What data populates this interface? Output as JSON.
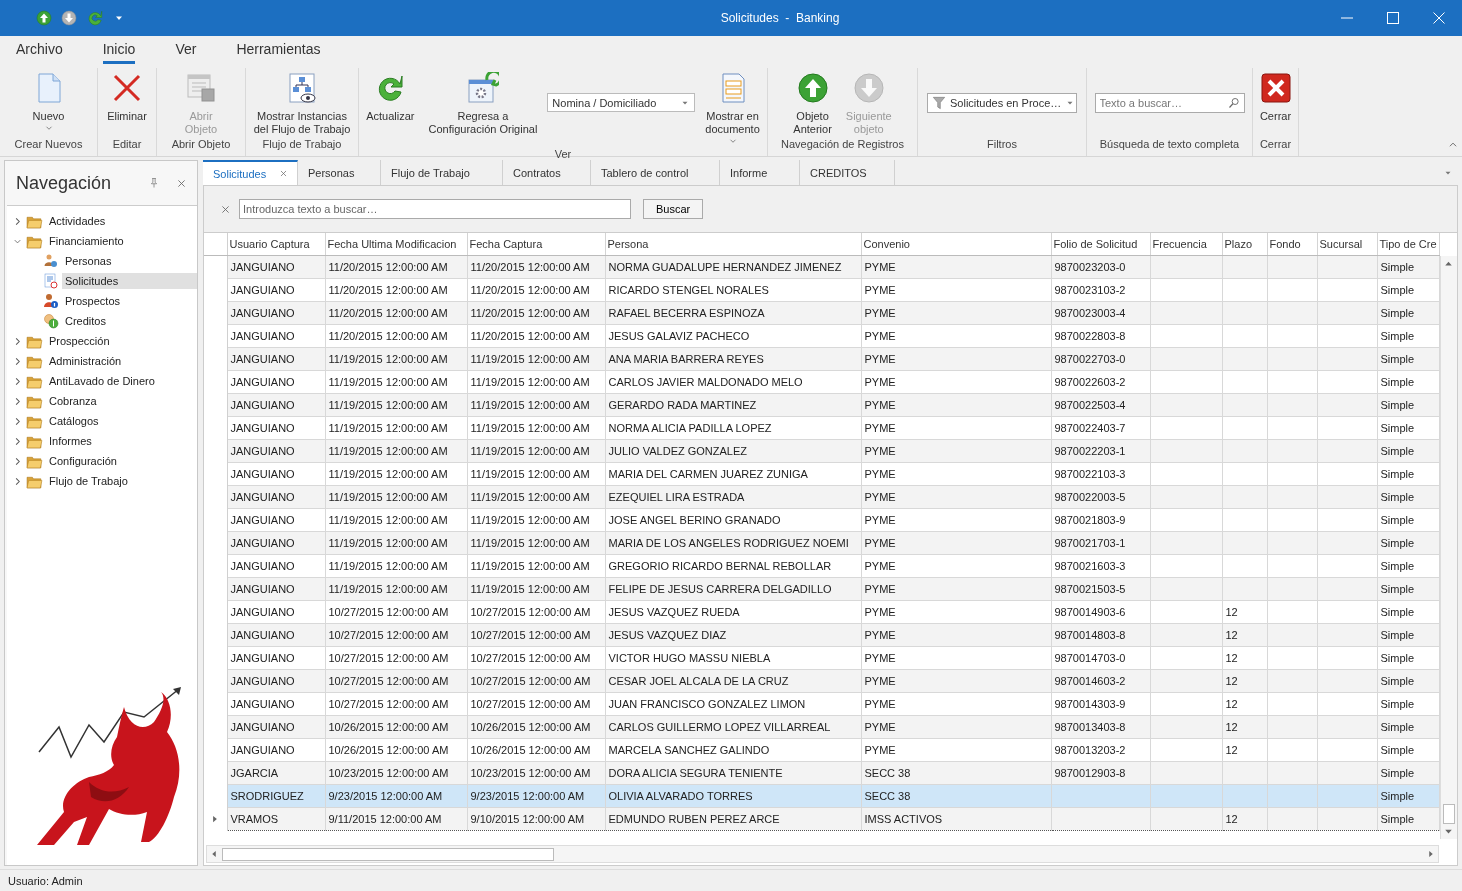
{
  "window": {
    "title": "Solicitudes  -  Banking"
  },
  "menu_tabs": [
    {
      "label": "Archivo",
      "selected": false
    },
    {
      "label": "Inicio",
      "selected": true
    },
    {
      "label": "Ver",
      "selected": false
    },
    {
      "label": "Herramientas",
      "selected": false
    }
  ],
  "ribbon": {
    "groups": [
      {
        "label": "Crear Nuevos",
        "items": [
          {
            "kind": "button",
            "label": "Nuevo",
            "disabled": false,
            "dropdown": true
          }
        ]
      },
      {
        "label": "Editar",
        "items": [
          {
            "kind": "button",
            "label": "Eliminar",
            "disabled": false,
            "dropdown": false
          }
        ]
      },
      {
        "label": "Abrir Objeto",
        "items": [
          {
            "kind": "button",
            "label": "Abrir\nObjeto",
            "disabled": true,
            "dropdown": false
          }
        ]
      },
      {
        "label": "Flujo de Trabajo",
        "items": [
          {
            "kind": "button",
            "label": "Mostrar Instancias\ndel Flujo de Trabajo",
            "disabled": false,
            "dropdown": false
          }
        ]
      },
      {
        "label": "Ver",
        "items": [
          {
            "kind": "button",
            "label": "Actualizar",
            "disabled": false,
            "dropdown": false
          },
          {
            "kind": "button",
            "label": "Regresa a\nConfiguración Original",
            "disabled": false,
            "dropdown": false
          },
          {
            "kind": "combo",
            "value": "Nomina / Domiciliado"
          },
          {
            "kind": "button",
            "label": "Mostrar en\ndocumento",
            "disabled": false,
            "dropdown": true
          }
        ]
      },
      {
        "label": "Navegación de Registros",
        "items": [
          {
            "kind": "button",
            "label": "Objeto\nAnterior",
            "disabled": false,
            "dropdown": false
          },
          {
            "kind": "button",
            "label": "Siguiente\nobjeto",
            "disabled": true,
            "dropdown": false
          }
        ]
      },
      {
        "label": "Filtros",
        "items": [
          {
            "kind": "filter",
            "value": "Solicitudes en Proce…"
          }
        ]
      },
      {
        "label": "Búsqueda de texto completa",
        "items": [
          {
            "kind": "search",
            "placeholder": "Texto a buscar…"
          }
        ]
      },
      {
        "label": "Cerrar",
        "items": [
          {
            "kind": "button",
            "label": "Cerrar",
            "disabled": false,
            "dropdown": false
          }
        ]
      }
    ]
  },
  "navigation": {
    "title": "Navegación",
    "tree": [
      {
        "label": "Actividades",
        "expanded": false,
        "selected": false
      },
      {
        "label": "Financiamiento",
        "expanded": true,
        "selected": false,
        "children": [
          {
            "label": "Personas",
            "selected": false
          },
          {
            "label": "Solicitudes",
            "selected": true
          },
          {
            "label": "Prospectos",
            "selected": false
          },
          {
            "label": "Creditos",
            "selected": false
          }
        ]
      },
      {
        "label": "Prospección",
        "expanded": false,
        "selected": false
      },
      {
        "label": "Administración",
        "expanded": false,
        "selected": false
      },
      {
        "label": "AntiLavado de Dinero",
        "expanded": false,
        "selected": false
      },
      {
        "label": "Cobranza",
        "expanded": false,
        "selected": false
      },
      {
        "label": "Catálogos",
        "expanded": false,
        "selected": false
      },
      {
        "label": "Informes",
        "expanded": false,
        "selected": false
      },
      {
        "label": "Configuración",
        "expanded": false,
        "selected": false
      },
      {
        "label": "Flujo de Trabajo",
        "expanded": false,
        "selected": false
      }
    ]
  },
  "doc_tabs": [
    {
      "label": "Solicitudes",
      "selected": true,
      "closable": true
    },
    {
      "label": "Personas",
      "selected": false,
      "closable": false
    },
    {
      "label": "Flujo de Trabajo",
      "selected": false,
      "closable": false
    },
    {
      "label": "Contratos",
      "selected": false,
      "closable": false
    },
    {
      "label": "Tablero de control",
      "selected": false,
      "closable": false
    },
    {
      "label": "Informe",
      "selected": false,
      "closable": false
    },
    {
      "label": "CREDITOS",
      "selected": false,
      "closable": false
    }
  ],
  "grid": {
    "search": {
      "placeholder": "Introduzca texto a buscar…",
      "button": "Buscar"
    },
    "columns": [
      "Usuario Captura",
      "Fecha Ultima Modificacion",
      "Fecha Captura",
      "Persona",
      "Convenio",
      "Folio de Solicitud",
      "Frecuencia",
      "Plazo",
      "Fondo",
      "Sucursal",
      "Tipo de Cre"
    ],
    "rows": [
      {
        "selected": false,
        "current": false,
        "cells": {
          "usuario": "JANGUIANO",
          "modificacion": "11/20/2015 12:00:00 AM",
          "captura": "11/20/2015 12:00:00 AM",
          "persona": "NORMA GUADALUPE HERNANDEZ JIMENEZ",
          "convenio": "PYME",
          "folio": "9870023203-0",
          "tipo": "Simple"
        }
      },
      {
        "selected": false,
        "current": false,
        "cells": {
          "usuario": "JANGUIANO",
          "modificacion": "11/20/2015 12:00:00 AM",
          "captura": "11/20/2015 12:00:00 AM",
          "persona": "RICARDO STENGEL NORALES",
          "convenio": "PYME",
          "folio": "9870023103-2",
          "tipo": "Simple"
        }
      },
      {
        "selected": false,
        "current": false,
        "cells": {
          "usuario": "JANGUIANO",
          "modificacion": "11/20/2015 12:00:00 AM",
          "captura": "11/20/2015 12:00:00 AM",
          "persona": "RAFAEL BECERRA ESPINOZA",
          "convenio": "PYME",
          "folio": "9870023003-4",
          "tipo": "Simple"
        }
      },
      {
        "selected": false,
        "current": false,
        "cells": {
          "usuario": "JANGUIANO",
          "modificacion": "11/20/2015 12:00:00 AM",
          "captura": "11/20/2015 12:00:00 AM",
          "persona": "JESUS GALAVIZ PACHECO",
          "convenio": "PYME",
          "folio": "9870022803-8",
          "tipo": "Simple"
        }
      },
      {
        "selected": false,
        "current": false,
        "cells": {
          "usuario": "JANGUIANO",
          "modificacion": "11/19/2015 12:00:00 AM",
          "captura": "11/19/2015 12:00:00 AM",
          "persona": "ANA MARIA BARRERA REYES",
          "convenio": "PYME",
          "folio": "9870022703-0",
          "tipo": "Simple"
        }
      },
      {
        "selected": false,
        "current": false,
        "cells": {
          "usuario": "JANGUIANO",
          "modificacion": "11/19/2015 12:00:00 AM",
          "captura": "11/19/2015 12:00:00 AM",
          "persona": "CARLOS JAVIER MALDONADO MELO",
          "convenio": "PYME",
          "folio": "9870022603-2",
          "tipo": "Simple"
        }
      },
      {
        "selected": false,
        "current": false,
        "cells": {
          "usuario": "JANGUIANO",
          "modificacion": "11/19/2015 12:00:00 AM",
          "captura": "11/19/2015 12:00:00 AM",
          "persona": "GERARDO RADA MARTINEZ",
          "convenio": "PYME",
          "folio": "9870022503-4",
          "tipo": "Simple"
        }
      },
      {
        "selected": false,
        "current": false,
        "cells": {
          "usuario": "JANGUIANO",
          "modificacion": "11/19/2015 12:00:00 AM",
          "captura": "11/19/2015 12:00:00 AM",
          "persona": "NORMA ALICIA PADILLA LOPEZ",
          "convenio": "PYME",
          "folio": "9870022403-7",
          "tipo": "Simple"
        }
      },
      {
        "selected": false,
        "current": false,
        "cells": {
          "usuario": "JANGUIANO",
          "modificacion": "11/19/2015 12:00:00 AM",
          "captura": "11/19/2015 12:00:00 AM",
          "persona": "JULIO VALDEZ GONZALEZ",
          "convenio": "PYME",
          "folio": "9870022203-1",
          "tipo": "Simple"
        }
      },
      {
        "selected": false,
        "current": false,
        "cells": {
          "usuario": "JANGUIANO",
          "modificacion": "11/19/2015 12:00:00 AM",
          "captura": "11/19/2015 12:00:00 AM",
          "persona": "MARIA DEL CARMEN JUAREZ ZUNIGA",
          "convenio": "PYME",
          "folio": "9870022103-3",
          "tipo": "Simple"
        }
      },
      {
        "selected": false,
        "current": false,
        "cells": {
          "usuario": "JANGUIANO",
          "modificacion": "11/19/2015 12:00:00 AM",
          "captura": "11/19/2015 12:00:00 AM",
          "persona": "EZEQUIEL LIRA ESTRADA",
          "convenio": "PYME",
          "folio": "9870022003-5",
          "tipo": "Simple"
        }
      },
      {
        "selected": false,
        "current": false,
        "cells": {
          "usuario": "JANGUIANO",
          "modificacion": "11/19/2015 12:00:00 AM",
          "captura": "11/19/2015 12:00:00 AM",
          "persona": "JOSE ANGEL BERINO GRANADO",
          "convenio": "PYME",
          "folio": "9870021803-9",
          "tipo": "Simple"
        }
      },
      {
        "selected": false,
        "current": false,
        "cells": {
          "usuario": "JANGUIANO",
          "modificacion": "11/19/2015 12:00:00 AM",
          "captura": "11/19/2015 12:00:00 AM",
          "persona": "MARIA DE LOS ANGELES RODRIGUEZ NOEMI",
          "convenio": "PYME",
          "folio": "9870021703-1",
          "tipo": "Simple"
        }
      },
      {
        "selected": false,
        "current": false,
        "cells": {
          "usuario": "JANGUIANO",
          "modificacion": "11/19/2015 12:00:00 AM",
          "captura": "11/19/2015 12:00:00 AM",
          "persona": "GREGORIO RICARDO BERNAL REBOLLAR",
          "convenio": "PYME",
          "folio": "9870021603-3",
          "tipo": "Simple"
        }
      },
      {
        "selected": false,
        "current": false,
        "cells": {
          "usuario": "JANGUIANO",
          "modificacion": "11/19/2015 12:00:00 AM",
          "captura": "11/19/2015 12:00:00 AM",
          "persona": "FELIPE DE JESUS CARRERA DELGADILLO",
          "convenio": "PYME",
          "folio": "9870021503-5",
          "tipo": "Simple"
        }
      },
      {
        "selected": false,
        "current": false,
        "cells": {
          "usuario": "JANGUIANO",
          "modificacion": "10/27/2015 12:00:00 AM",
          "captura": "10/27/2015 12:00:00 AM",
          "persona": "JESUS VAZQUEZ RUEDA",
          "convenio": "PYME",
          "folio": "9870014903-6",
          "plazo": "12",
          "tipo": "Simple"
        }
      },
      {
        "selected": false,
        "current": false,
        "cells": {
          "usuario": "JANGUIANO",
          "modificacion": "10/27/2015 12:00:00 AM",
          "captura": "10/27/2015 12:00:00 AM",
          "persona": "JESUS VAZQUEZ DIAZ",
          "convenio": "PYME",
          "folio": "9870014803-8",
          "plazo": "12",
          "tipo": "Simple"
        }
      },
      {
        "selected": false,
        "current": false,
        "cells": {
          "usuario": "JANGUIANO",
          "modificacion": "10/27/2015 12:00:00 AM",
          "captura": "10/27/2015 12:00:00 AM",
          "persona": "VICTOR HUGO MASSU NIEBLA",
          "convenio": "PYME",
          "folio": "9870014703-0",
          "plazo": "12",
          "tipo": "Simple"
        }
      },
      {
        "selected": false,
        "current": false,
        "cells": {
          "usuario": "JANGUIANO",
          "modificacion": "10/27/2015 12:00:00 AM",
          "captura": "10/27/2015 12:00:00 AM",
          "persona": "CESAR JOEL ALCALA DE LA CRUZ",
          "convenio": "PYME",
          "folio": "9870014603-2",
          "plazo": "12",
          "tipo": "Simple"
        }
      },
      {
        "selected": false,
        "current": false,
        "cells": {
          "usuario": "JANGUIANO",
          "modificacion": "10/27/2015 12:00:00 AM",
          "captura": "10/27/2015 12:00:00 AM",
          "persona": "JUAN FRANCISCO GONZALEZ LIMON",
          "convenio": "PYME",
          "folio": "9870014303-9",
          "plazo": "12",
          "tipo": "Simple"
        }
      },
      {
        "selected": false,
        "current": false,
        "cells": {
          "usuario": "JANGUIANO",
          "modificacion": "10/26/2015 12:00:00 AM",
          "captura": "10/26/2015 12:00:00 AM",
          "persona": "CARLOS GUILLERMO LOPEZ VILLARREAL",
          "convenio": "PYME",
          "folio": "9870013403-8",
          "plazo": "12",
          "tipo": "Simple"
        }
      },
      {
        "selected": false,
        "current": false,
        "cells": {
          "usuario": "JANGUIANO",
          "modificacion": "10/26/2015 12:00:00 AM",
          "captura": "10/26/2015 12:00:00 AM",
          "persona": "MARCELA SANCHEZ GALINDO",
          "convenio": "PYME",
          "folio": "9870013203-2",
          "plazo": "12",
          "tipo": "Simple"
        }
      },
      {
        "selected": false,
        "current": false,
        "cells": {
          "usuario": "JGARCIA",
          "modificacion": "10/23/2015 12:00:00 AM",
          "captura": "10/23/2015 12:00:00 AM",
          "persona": "DORA ALICIA SEGURA TENIENTE",
          "convenio": "SECC 38",
          "folio": "9870012903-8",
          "tipo": "Simple"
        }
      },
      {
        "selected": true,
        "current": false,
        "cells": {
          "usuario": "SRODRIGUEZ",
          "modificacion": "9/23/2015 12:00:00 AM",
          "captura": "9/23/2015 12:00:00 AM",
          "persona": "OLIVIA ALVARADO TORRES",
          "convenio": "SECC 38",
          "tipo": "Simple"
        }
      },
      {
        "selected": false,
        "current": true,
        "cells": {
          "usuario": "VRAMOS",
          "modificacion": "9/11/2015 12:00:00 AM",
          "captura": "9/10/2015 12:00:00 AM",
          "persona": "EDMUNDO RUBEN PEREZ ARCE",
          "convenio": "IMSS ACTIVOS",
          "plazo": "12",
          "tipo": "Simple"
        }
      }
    ]
  },
  "status_bar": {
    "text": "Usuario: Admin"
  }
}
